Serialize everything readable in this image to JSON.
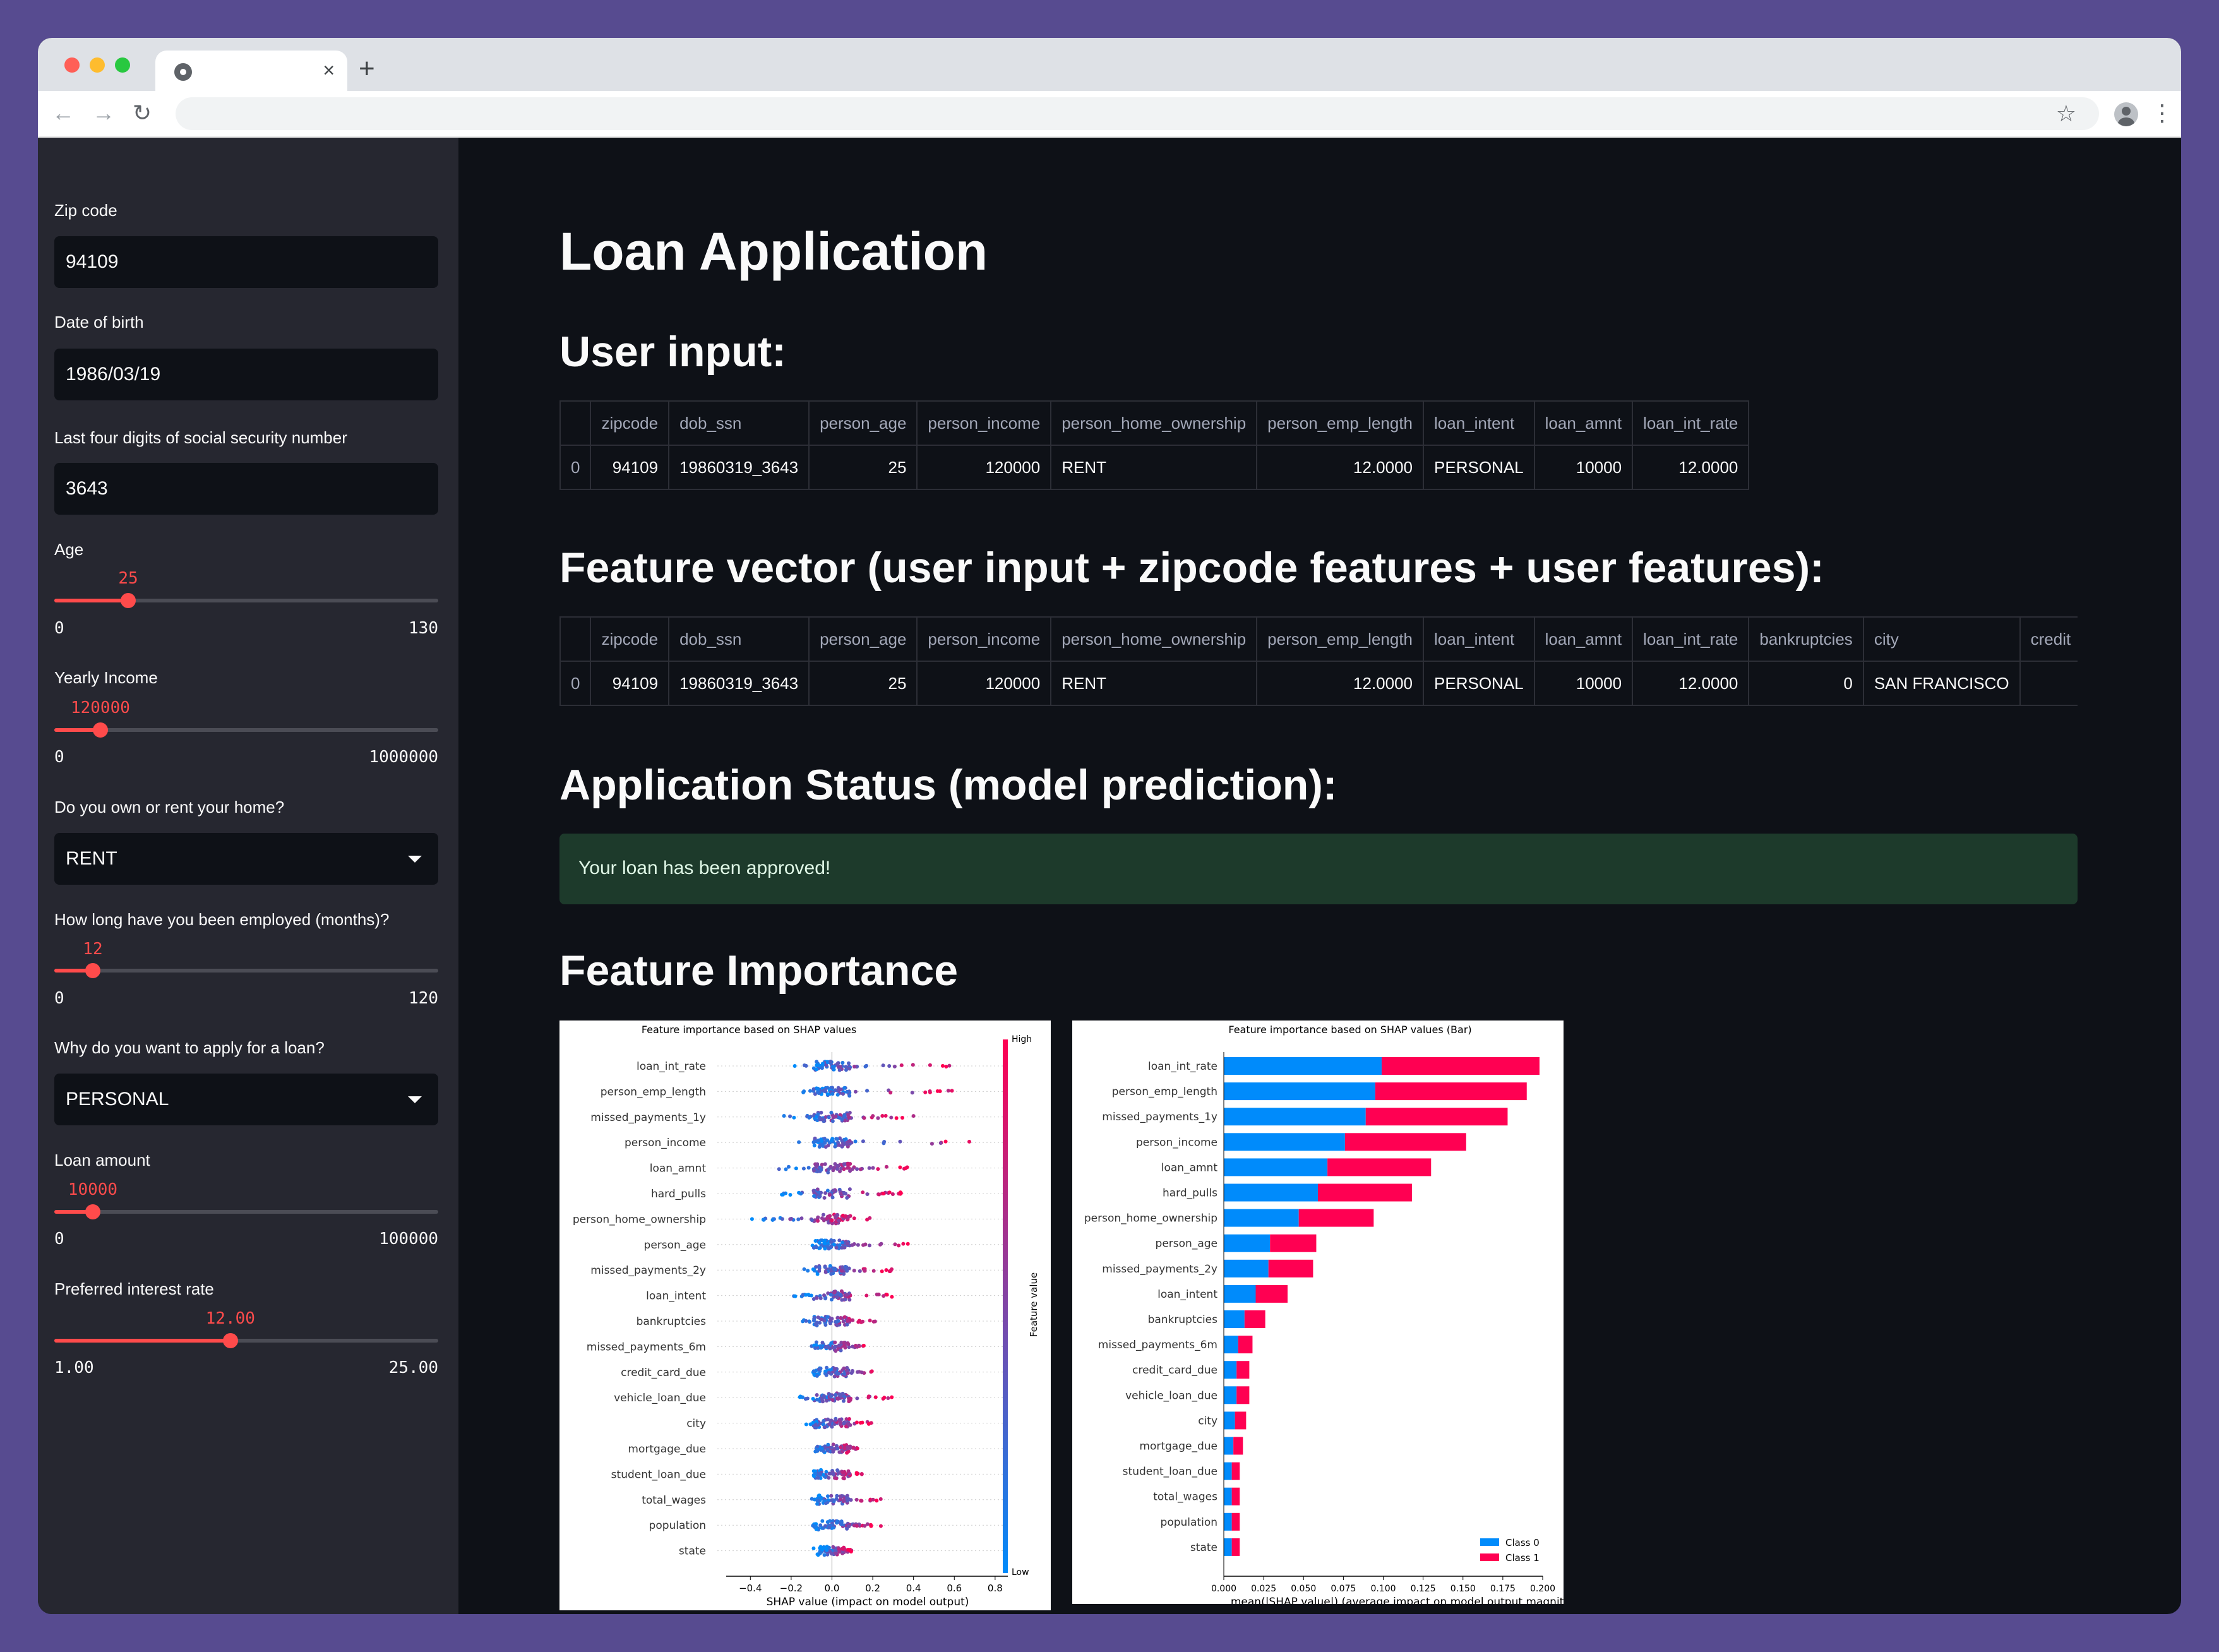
{
  "browser": {
    "tab_close": "×",
    "new_tab": "+",
    "back_icon": "←",
    "forward_icon": "→",
    "reload_icon": "↻",
    "star_icon": "☆",
    "menu_icon": "⋮"
  },
  "sidebar": {
    "zip": {
      "label": "Zip code",
      "value": "94109"
    },
    "dob": {
      "label": "Date of birth",
      "value": "1986/03/19"
    },
    "ssn": {
      "label": "Last four digits of social security number",
      "value": "3643"
    },
    "age": {
      "label": "Age",
      "value": "25",
      "min": "0",
      "max": "130",
      "level": 0.1923
    },
    "income": {
      "label": "Yearly Income",
      "value": "120000",
      "min": "0",
      "max": "1000000",
      "level": 0.12
    },
    "home": {
      "label": "Do you own or rent your home?",
      "value": "RENT"
    },
    "employed": {
      "label": "How long have you been employed (months)?",
      "value": "12",
      "min": "0",
      "max": "120",
      "level": 0.1
    },
    "intent": {
      "label": "Why do you want to apply for a loan?",
      "value": "PERSONAL"
    },
    "amount": {
      "label": "Loan amount",
      "value": "10000",
      "min": "0",
      "max": "100000",
      "level": 0.1
    },
    "rate": {
      "label": "Preferred interest rate",
      "value": "12.00",
      "min": "1.00",
      "max": "25.00",
      "level": 0.4583
    }
  },
  "main": {
    "title": "Loan Application",
    "user_input_heading": "User input:",
    "user_input_table": {
      "columns": [
        "",
        "zipcode",
        "dob_ssn",
        "person_age",
        "person_income",
        "person_home_ownership",
        "person_emp_length",
        "loan_intent",
        "loan_amnt",
        "loan_int_rate"
      ],
      "row": [
        "0",
        "94109",
        "19860319_3643",
        "25",
        "120000",
        "RENT",
        "12.0000",
        "PERSONAL",
        "10000",
        "12.0000"
      ]
    },
    "feature_heading": "Feature vector (user input + zipcode features + user features):",
    "feature_table": {
      "columns": [
        "",
        "zipcode",
        "dob_ssn",
        "person_age",
        "person_income",
        "person_home_ownership",
        "person_emp_length",
        "loan_intent",
        "loan_amnt",
        "loan_int_rate",
        "bankruptcies",
        "city",
        "credit"
      ],
      "row": [
        "0",
        "94109",
        "19860319_3643",
        "25",
        "120000",
        "RENT",
        "12.0000",
        "PERSONAL",
        "10000",
        "12.0000",
        "0",
        "SAN FRANCISCO",
        ""
      ]
    },
    "status_heading": "Application Status (model prediction):",
    "status_message": "Your loan has been approved!",
    "importance_heading": "Feature Importance"
  },
  "chart_data": [
    {
      "type": "scatter",
      "title": "Feature importance based on SHAP values",
      "xlabel": "SHAP value (impact on model output)",
      "xlim": [
        -0.5,
        0.85
      ],
      "xticks": [
        "−0.4",
        "−0.2",
        "0.0",
        "0.2",
        "0.4",
        "0.6",
        "0.8"
      ],
      "features": [
        "loan_int_rate",
        "person_emp_length",
        "missed_payments_1y",
        "person_income",
        "loan_amnt",
        "hard_pulls",
        "person_home_ownership",
        "person_age",
        "missed_payments_2y",
        "loan_intent",
        "bankruptcies",
        "missed_payments_6m",
        "credit_card_due",
        "vehicle_loan_due",
        "city",
        "mortgage_due",
        "student_loan_due",
        "total_wages",
        "population",
        "state"
      ],
      "colorbar": {
        "label": "Feature value",
        "high": "High",
        "low": "Low",
        "low_color": "#008bfb",
        "high_color": "#ff0052"
      },
      "spread": [
        [
          -0.2,
          0.62
        ],
        [
          -0.15,
          0.6
        ],
        [
          -0.25,
          0.45
        ],
        [
          -0.25,
          0.8
        ],
        [
          -0.35,
          0.4
        ],
        [
          -0.25,
          0.35
        ],
        [
          -0.4,
          0.2
        ],
        [
          -0.1,
          0.4
        ],
        [
          -0.15,
          0.3
        ],
        [
          -0.2,
          0.3
        ],
        [
          -0.15,
          0.25
        ],
        [
          -0.1,
          0.2
        ],
        [
          -0.1,
          0.25
        ],
        [
          -0.2,
          0.35
        ],
        [
          -0.15,
          0.2
        ],
        [
          -0.1,
          0.15
        ],
        [
          -0.1,
          0.15
        ],
        [
          -0.1,
          0.25
        ],
        [
          -0.1,
          0.25
        ],
        [
          -0.05,
          0.1
        ]
      ]
    },
    {
      "type": "bar",
      "title": "Feature importance based on SHAP values (Bar)",
      "xlabel": "mean(|SHAP value|) (average impact on model output magnitu",
      "xlim": [
        0,
        0.2
      ],
      "xticks": [
        "0.000",
        "0.025",
        "0.050",
        "0.075",
        "0.100",
        "0.125",
        "0.150",
        "0.175",
        "0.200"
      ],
      "categories": [
        "loan_int_rate",
        "person_emp_length",
        "missed_payments_1y",
        "person_income",
        "loan_amnt",
        "hard_pulls",
        "person_home_ownership",
        "person_age",
        "missed_payments_2y",
        "loan_intent",
        "bankruptcies",
        "missed_payments_6m",
        "credit_card_due",
        "vehicle_loan_due",
        "city",
        "mortgage_due",
        "student_loan_due",
        "total_wages",
        "population",
        "state"
      ],
      "series": [
        {
          "name": "Class 0",
          "color": "#008bfb",
          "values": [
            0.099,
            0.095,
            0.089,
            0.076,
            0.065,
            0.059,
            0.047,
            0.029,
            0.028,
            0.02,
            0.013,
            0.009,
            0.008,
            0.008,
            0.007,
            0.006,
            0.005,
            0.005,
            0.005,
            0.005
          ]
        },
        {
          "name": "Class 1",
          "color": "#ff0052",
          "values": [
            0.099,
            0.095,
            0.089,
            0.076,
            0.065,
            0.059,
            0.047,
            0.029,
            0.028,
            0.02,
            0.013,
            0.009,
            0.008,
            0.008,
            0.007,
            0.006,
            0.005,
            0.005,
            0.005,
            0.005
          ]
        }
      ]
    }
  ]
}
